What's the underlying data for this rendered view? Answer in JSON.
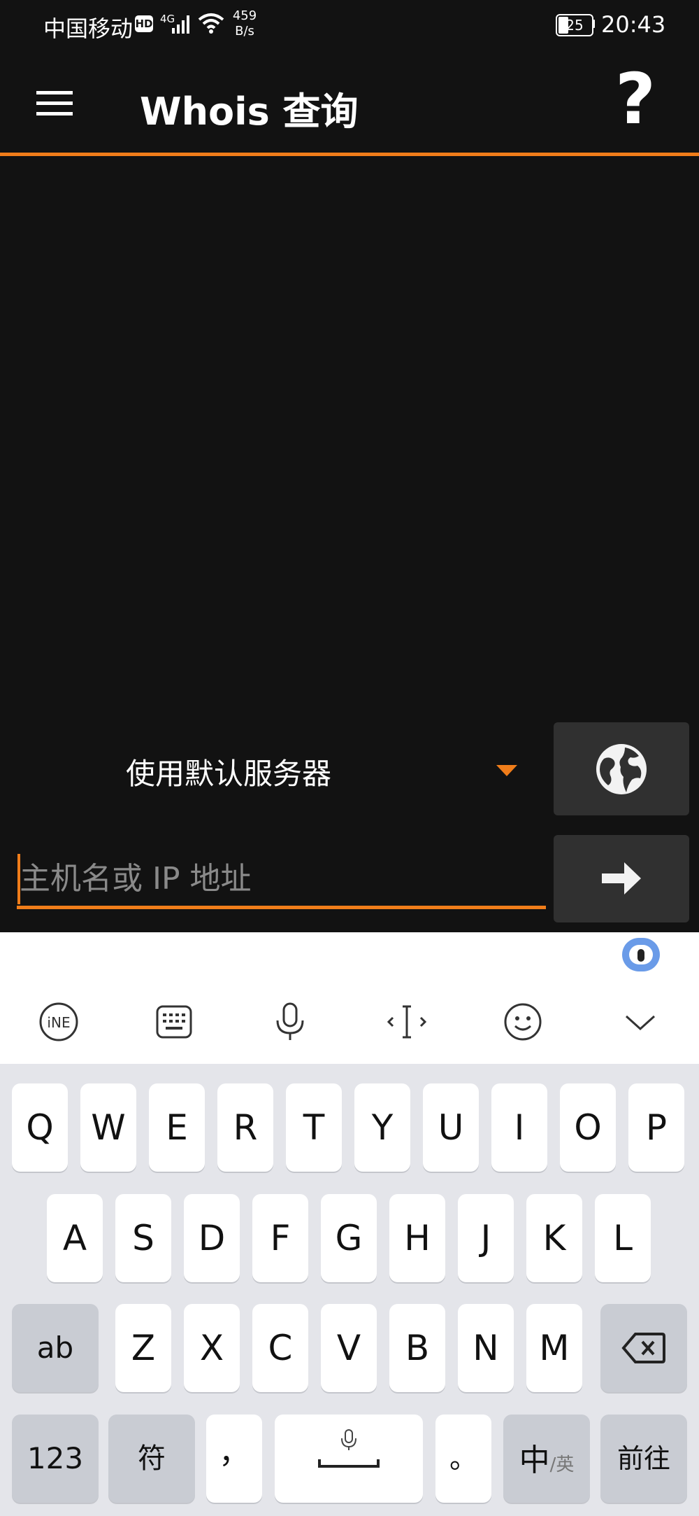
{
  "status_bar": {
    "carrier": "中国移动",
    "hd_badge": "HD",
    "network": "4G",
    "speed_value": "459",
    "speed_unit": "B/s",
    "battery": "25",
    "time": "20:43"
  },
  "app_bar": {
    "title": "Whois 查询",
    "menu_icon": "hamburger-icon",
    "help_label": "?"
  },
  "server_selector": {
    "selected": "使用默认服务器"
  },
  "host_input": {
    "placeholder": "主机名或 IP 地址",
    "value": ""
  },
  "keyboard": {
    "toolbar": [
      "ime-logo-icon",
      "keyboard-icon",
      "microphone-icon",
      "cursor-icon",
      "emoji-icon",
      "collapse-icon"
    ],
    "row1": [
      "Q",
      "W",
      "E",
      "R",
      "T",
      "Y",
      "U",
      "I",
      "O",
      "P"
    ],
    "row2": [
      "A",
      "S",
      "D",
      "F",
      "G",
      "H",
      "J",
      "K",
      "L"
    ],
    "row3": [
      "Z",
      "X",
      "C",
      "V",
      "B",
      "N",
      "M"
    ],
    "shift_label": "ab",
    "numbers_label": "123",
    "symbols_label": "符",
    "comma_label": "，",
    "period_label": "。",
    "lang_main": "中",
    "lang_alt": "/英",
    "enter_label": "前往"
  },
  "colors": {
    "accent": "#f07d1a",
    "background": "#121212",
    "button": "#303030",
    "keyboard_bg": "#e4e5ea"
  }
}
